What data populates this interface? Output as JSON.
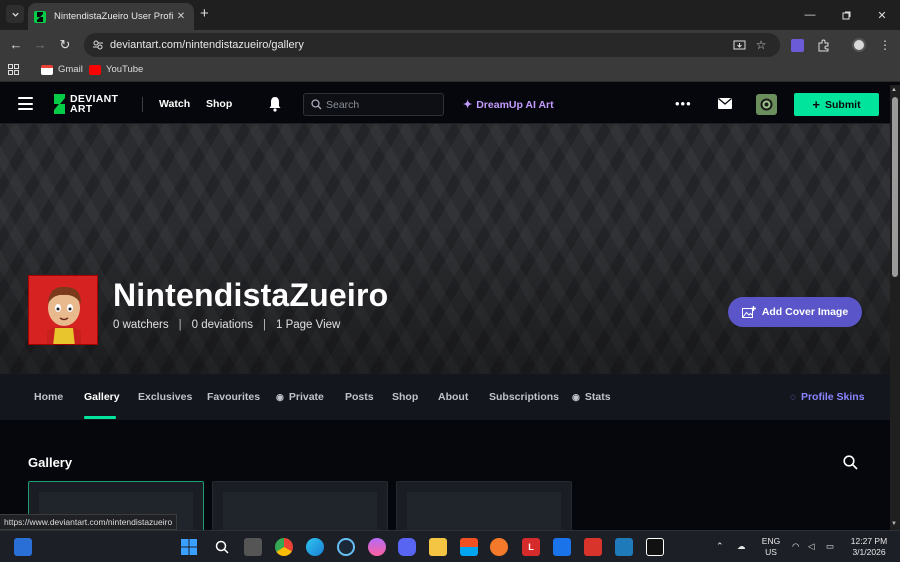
{
  "browser": {
    "tab_title": "NintendistaZueiro User Profile | DeviantArt",
    "url": "deviantart.com/nintendistazueiro/gallery",
    "new_tab_symbol": "+",
    "bookmarks": [
      {
        "label": "Gmail",
        "icon": "gmail-icon",
        "color": "#ea4335"
      },
      {
        "label": "YouTube",
        "icon": "youtube-icon",
        "color": "#ff0000"
      }
    ],
    "status_url": "https://www.deviantart.com/nintendistazueiro"
  },
  "header": {
    "logo_line1": "DEVIANT",
    "logo_line2": "ART",
    "nav": [
      "Watch",
      "Shop"
    ],
    "search_placeholder": "Search",
    "dreamup_label": "DreamUp AI Art",
    "submit_label": "Submit",
    "accent": "#00e59b"
  },
  "profile": {
    "username": "NintendistaZueiro",
    "watchers": "0 watchers",
    "deviations": "0 deviations",
    "page_views": "1 Page View",
    "separator": "|",
    "add_cover_label": "Add Cover Image"
  },
  "tabs": [
    {
      "label": "Home"
    },
    {
      "label": "Gallery",
      "active": true
    },
    {
      "label": "Exclusives"
    },
    {
      "label": "Favourites"
    },
    {
      "label": "Private",
      "icon": "eye-icon"
    },
    {
      "label": "Posts"
    },
    {
      "label": "Shop"
    },
    {
      "label": "About"
    },
    {
      "label": "Subscriptions"
    },
    {
      "label": "Stats",
      "icon": "eye-icon"
    }
  ],
  "profile_skins_label": "Profile Skins",
  "gallery": {
    "title": "Gallery"
  },
  "taskbar": {
    "language_line1": "ENG",
    "language_line2": "US",
    "time": "12:27 PM",
    "date": "3/1/2026"
  }
}
